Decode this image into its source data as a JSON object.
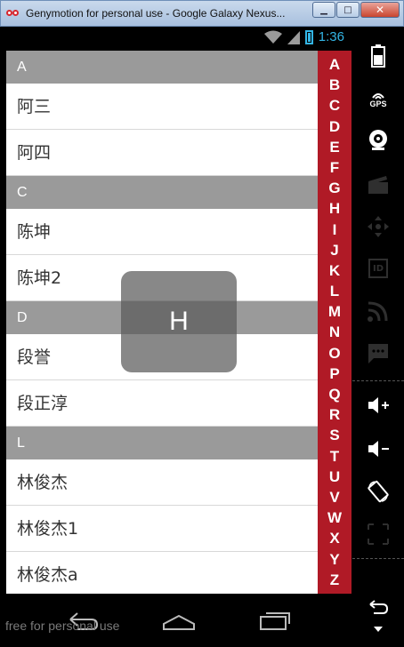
{
  "window": {
    "title": "Genymotion for personal use - Google Galaxy Nexus...",
    "minimize": "▁",
    "maximize": "□",
    "close": "✕"
  },
  "status_bar": {
    "time": "1:36"
  },
  "list": {
    "sections": [
      {
        "header": "A",
        "items": [
          "阿三",
          "阿四"
        ]
      },
      {
        "header": "C",
        "items": [
          "陈坤",
          "陈坤2"
        ]
      },
      {
        "header": "D",
        "items": [
          "段誉",
          "段正淳"
        ]
      },
      {
        "header": "L",
        "items": [
          "林俊杰",
          "林俊杰1",
          "林俊杰a"
        ]
      }
    ]
  },
  "index_bar": [
    "A",
    "B",
    "C",
    "D",
    "E",
    "F",
    "G",
    "H",
    "I",
    "J",
    "K",
    "L",
    "M",
    "N",
    "O",
    "P",
    "Q",
    "R",
    "S",
    "T",
    "U",
    "V",
    "W",
    "X",
    "Y",
    "Z"
  ],
  "overlay": {
    "letter": "H"
  },
  "watermark": "free for personal use",
  "sidebar": {
    "gps_label": "GPS",
    "id_label": "ID"
  },
  "colors": {
    "accent_index_bar": "#b01a26",
    "section_header": "#9a9a9a",
    "status_blue": "#33b5e5"
  }
}
